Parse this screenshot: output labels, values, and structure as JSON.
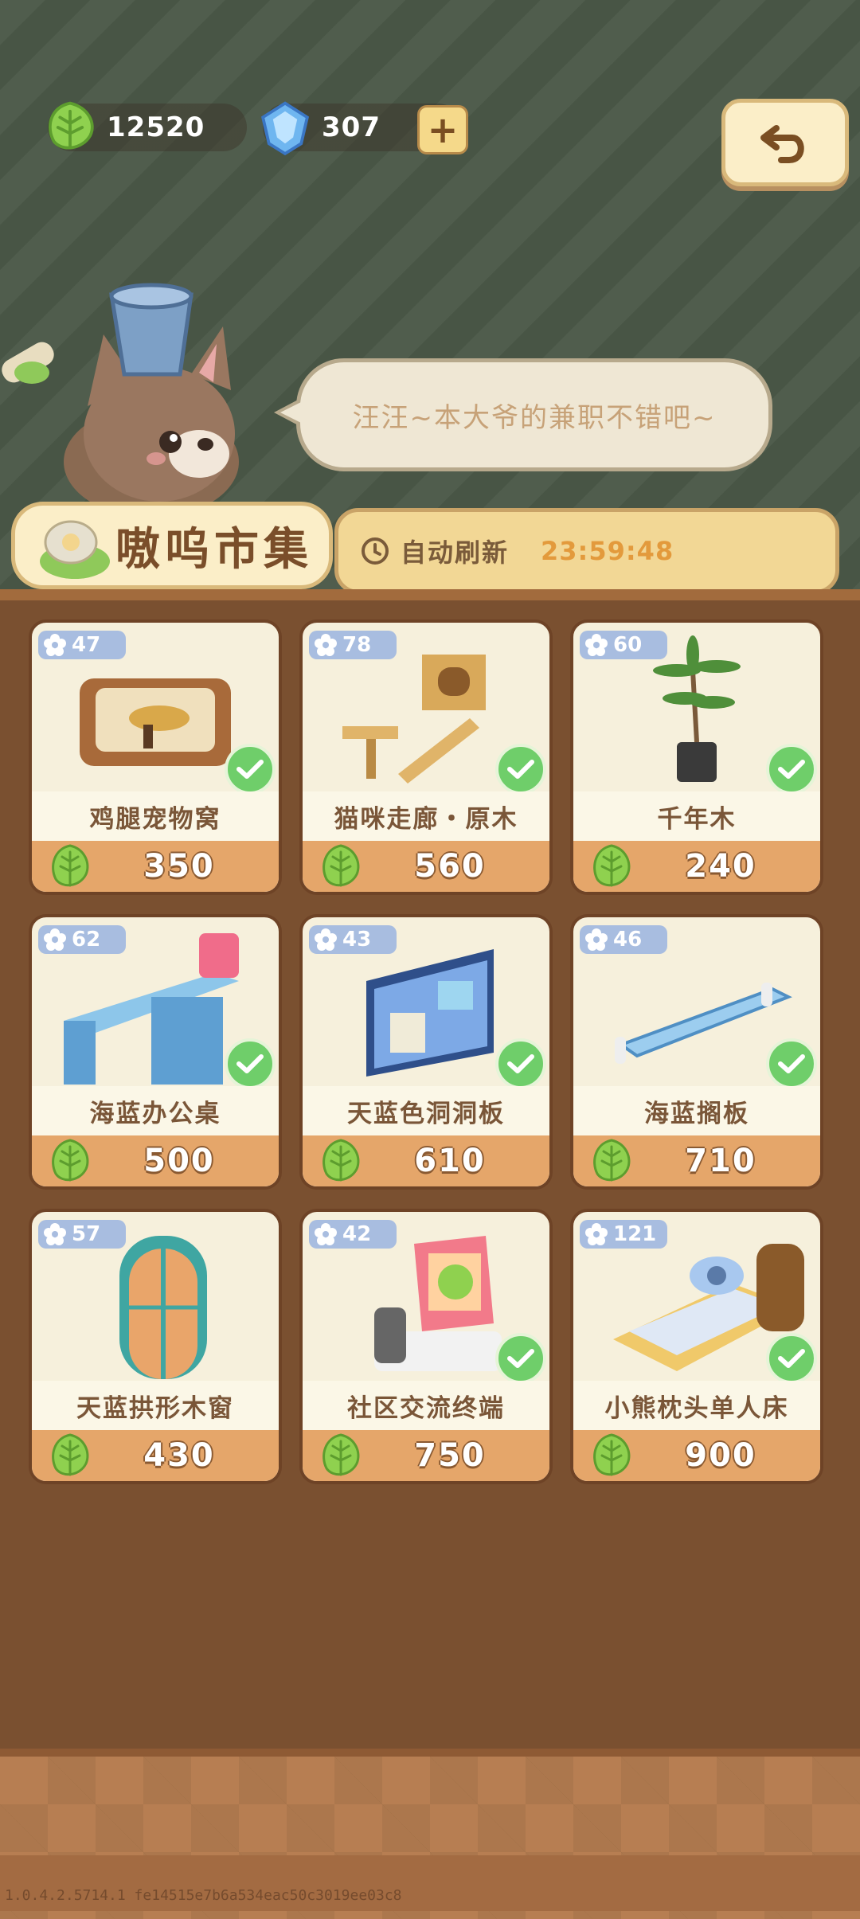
{
  "currency": {
    "leaf_amount": "12520",
    "gem_amount": "307",
    "plus_label": "+"
  },
  "speech": "汪汪~本大爷的兼职不错吧~",
  "market": {
    "title": "嗷呜市集",
    "refresh_label": "自动刷新",
    "refresh_time": "23:59:48"
  },
  "items": [
    {
      "name": "鸡腿宠物窝",
      "rating": "47",
      "price": "350",
      "owned": true
    },
    {
      "name": "猫咪走廊・原木",
      "rating": "78",
      "price": "560",
      "owned": true
    },
    {
      "name": "千年木",
      "rating": "60",
      "price": "240",
      "owned": true
    },
    {
      "name": "海蓝办公桌",
      "rating": "62",
      "price": "500",
      "owned": true
    },
    {
      "name": "天蓝色洞洞板",
      "rating": "43",
      "price": "610",
      "owned": true
    },
    {
      "name": "海蓝搁板",
      "rating": "46",
      "price": "710",
      "owned": true
    },
    {
      "name": "天蓝拱形木窗",
      "rating": "57",
      "price": "430",
      "owned": false
    },
    {
      "name": "社区交流终端",
      "rating": "42",
      "price": "750",
      "owned": true
    },
    {
      "name": "小熊枕头单人床",
      "rating": "121",
      "price": "900",
      "owned": true
    }
  ],
  "version": "1.0.4.2.5714.1 fe14515e7b6a534eac50c3019ee03c8",
  "colors": {
    "leaf": "#8fd14f",
    "check": "#6fce6a",
    "price_bg": "#e5a66a",
    "badge": "#a8bde0",
    "timer": "#e39a3c"
  }
}
